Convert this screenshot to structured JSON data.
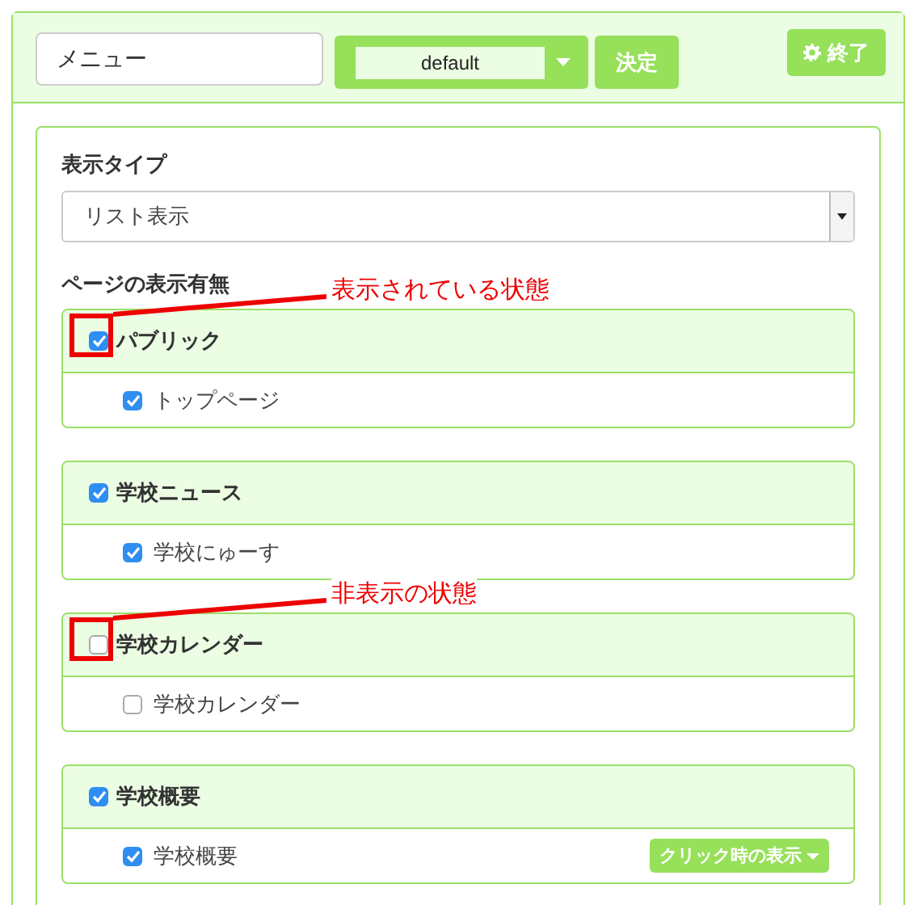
{
  "header": {
    "name_field": {
      "value": "メニュー"
    },
    "theme_select": {
      "value": "default"
    },
    "apply_button": "決定",
    "exit_button": "終了"
  },
  "display_type": {
    "label": "表示タイプ",
    "select": {
      "value": "リスト表示"
    }
  },
  "visibility": {
    "label": "ページの表示有無",
    "groups": [
      {
        "title": "パブリック",
        "checked": true,
        "annotation": "表示されている状態",
        "items": [
          {
            "label": "トップページ",
            "checked": true
          }
        ]
      },
      {
        "title": "学校ニュース",
        "checked": true,
        "items": [
          {
            "label": "学校にゅーす",
            "checked": true
          }
        ]
      },
      {
        "title": "学校カレンダー",
        "checked": false,
        "annotation": "非表示の状態",
        "items": [
          {
            "label": "学校カレンダー",
            "checked": false
          }
        ]
      },
      {
        "title": "学校概要",
        "checked": true,
        "items": [
          {
            "label": "学校概要",
            "checked": true,
            "dropdown": "クリック時の表示"
          }
        ]
      }
    ]
  }
}
